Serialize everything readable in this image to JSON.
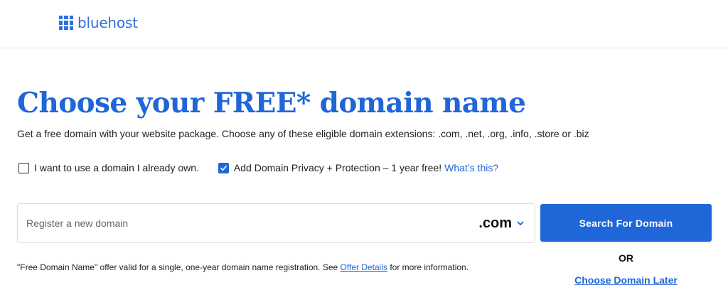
{
  "header": {
    "logo_text": "bluehost"
  },
  "main": {
    "title": "Choose your FREE* domain name",
    "subtitle": "Get a free domain with your website package. Choose any of these eligible domain extensions: .com, .net, .org, .info, .store or .biz",
    "options": {
      "own_domain": {
        "label": "I want to use a domain I already own.",
        "checked": false
      },
      "privacy": {
        "label": "Add Domain Privacy + Protection – 1 year free!",
        "checked": true,
        "link": "What’s this?"
      }
    },
    "search": {
      "placeholder": "Register a new domain",
      "value": "",
      "tld": ".com"
    },
    "search_button": "Search For Domain",
    "or_text": "OR",
    "choose_later": "Choose Domain Later",
    "disclaimer": {
      "before": "\"Free Domain Name\" offer valid for a single, one-year domain name registration. See ",
      "link": "Offer Details",
      "after": " for more information."
    }
  },
  "colors": {
    "brand_blue": "#1f66d8",
    "logo_blue": "#2f6fdb"
  }
}
